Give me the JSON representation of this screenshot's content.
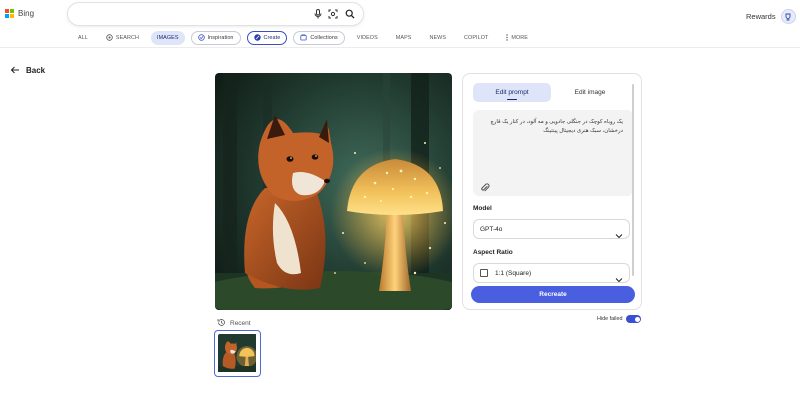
{
  "brand": {
    "name": "Bing",
    "rewards_label": "Rewards"
  },
  "search": {
    "value": "",
    "placeholder": ""
  },
  "nav": [
    {
      "label": "ALL",
      "icon": ""
    },
    {
      "label": "SEARCH",
      "icon": "copilot-search-icon"
    },
    {
      "label": "IMAGES",
      "icon": ""
    },
    {
      "label": "Inspiration",
      "icon": "inspiration-icon"
    },
    {
      "label": "Create",
      "icon": "create-icon"
    },
    {
      "label": "Collections",
      "icon": "collections-icon"
    },
    {
      "label": "VIDEOS",
      "icon": ""
    },
    {
      "label": "MAPS",
      "icon": ""
    },
    {
      "label": "NEWS",
      "icon": ""
    },
    {
      "label": "COPILOT",
      "icon": ""
    },
    {
      "label": "MORE",
      "icon": "more-vertical-icon"
    }
  ],
  "back_label": "Back",
  "editor": {
    "tabs": [
      {
        "label": "Edit prompt"
      },
      {
        "label": "Edit image"
      }
    ],
    "prompt": "یک روباه کوچک در جنگلی جادویی و مه آلود، در کنار یک قارچ درخشان، سبک هنری دیجیتال پینتینگ",
    "model_label": "Model",
    "model_value": "GPT-4o",
    "aspect_label": "Aspect Ratio",
    "aspect_value": "1:1 (Square)",
    "recreate_label": "Recreate"
  },
  "recent": {
    "label": "Recent",
    "hide_failed_label": "Hide failed",
    "hide_failed_on": true
  },
  "colors": {
    "accent": "#4a5fe0",
    "active_tab": "#dfe5f8",
    "toggle": "#3a4fd2"
  }
}
